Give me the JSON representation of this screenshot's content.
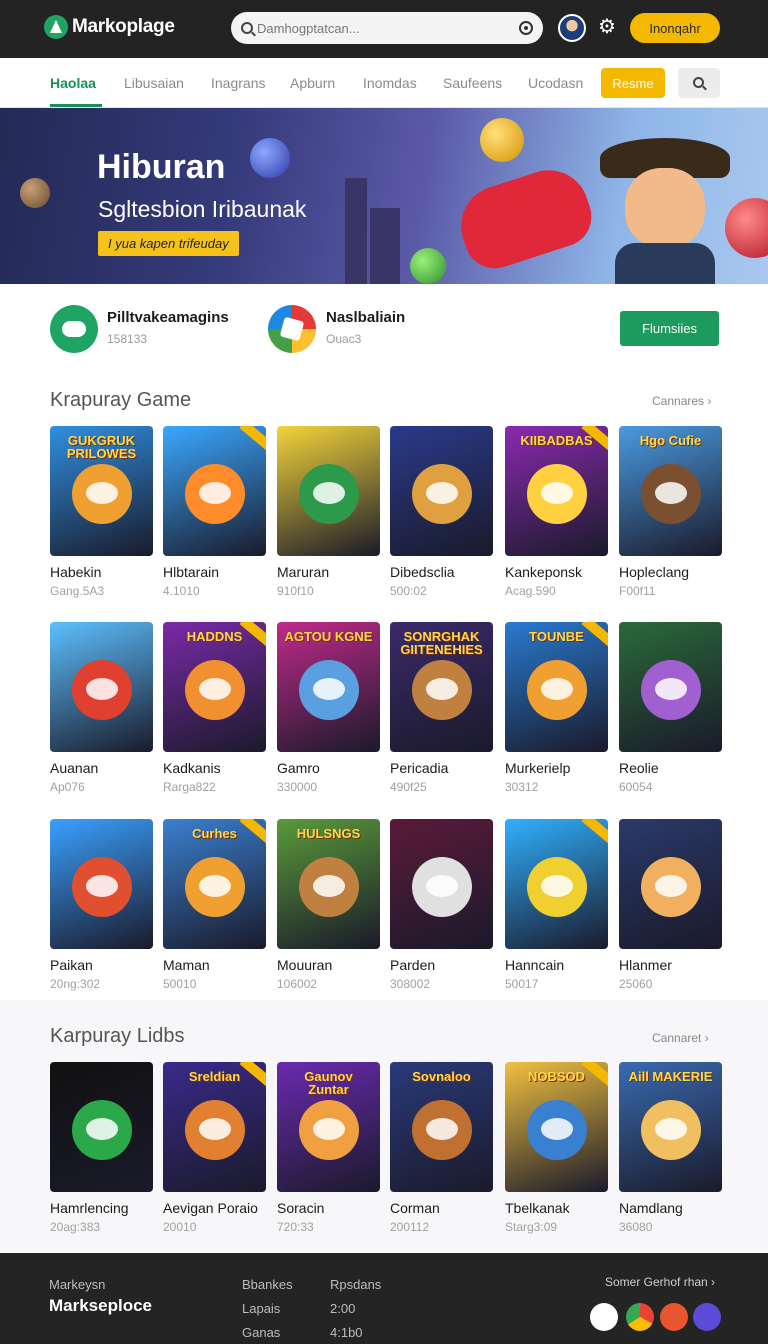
{
  "header": {
    "app_name": "Markoplage",
    "search_placeholder": "Damhogptatcan...",
    "cta_label": "Inonqahr",
    "icons": [
      "logo-icon",
      "search-icon",
      "mic-icon",
      "avatar",
      "gear-icon"
    ]
  },
  "nav": {
    "tabs": [
      "Haolaa",
      "Libusaian",
      "Inagrans",
      "Apburn",
      "Inomdas",
      "Saufeens",
      "Ucodasn"
    ],
    "active_tab": "Haolaa",
    "pill_label": "Resme"
  },
  "hero": {
    "title": "Hiburan",
    "subtitle": "Sgltesbion Iribaunak",
    "tag": "I yua kapen trifeuday"
  },
  "featured": {
    "items": [
      {
        "name": "Pilltvakeamagins",
        "meta": "158133"
      },
      {
        "name": "Naslbaliain",
        "meta": "Ouac3"
      }
    ],
    "button_label": "Flumsiies"
  },
  "section1": {
    "title": "Krapuray Game",
    "link": "Cannares",
    "cards": [
      {
        "name": "Habekin",
        "sub": "Gang.5A3",
        "art": "GUKGRUK PRILOWES"
      },
      {
        "name": "Hlbtarain",
        "sub": "4.1010",
        "art": ""
      },
      {
        "name": "Maruran",
        "sub": "910f10",
        "art": ""
      },
      {
        "name": "Dibedsclia",
        "sub": "500:02",
        "art": ""
      },
      {
        "name": "Kankeponsk",
        "sub": "Acag.590",
        "art": "KIIBADBAS"
      },
      {
        "name": "Hopleclang",
        "sub": "F00f11",
        "art": "Hgo Cufie"
      },
      {
        "name": "Auanan",
        "sub": "Ap076",
        "art": ""
      },
      {
        "name": "Kadkanis",
        "sub": "Rarga822",
        "art": "HADDNS"
      },
      {
        "name": "Gamro",
        "sub": "330000",
        "art": "AGTOU KGNE"
      },
      {
        "name": "Pericadia",
        "sub": "490f25",
        "art": "SONRGHAK GIITENEHIES"
      },
      {
        "name": "Murkerielp",
        "sub": "30312",
        "art": "TOUNBE"
      },
      {
        "name": "Reolie",
        "sub": "60054",
        "art": ""
      },
      {
        "name": "Paikan",
        "sub": "20ng:302",
        "art": ""
      },
      {
        "name": "Maman",
        "sub": "50010",
        "art": "Curhes"
      },
      {
        "name": "Mouuran",
        "sub": "106002",
        "art": "HULSNGS"
      },
      {
        "name": "Parden",
        "sub": "308002",
        "art": ""
      },
      {
        "name": "Hanncain",
        "sub": "50017",
        "art": ""
      },
      {
        "name": "Hlanmer",
        "sub": "25060",
        "art": ""
      }
    ]
  },
  "section2": {
    "title": "Karpuray Lidbs",
    "link": "Cannaret",
    "cards": [
      {
        "name": "Hamrlencing",
        "sub": "20ag:383",
        "art": ""
      },
      {
        "name": "Aevigan Poraio",
        "sub": "20010",
        "art": "Sreldian"
      },
      {
        "name": "Soracin",
        "sub": "720:33",
        "art": "Gaunov Zuntar"
      },
      {
        "name": "Corman",
        "sub": "200112",
        "art": "Sovnaloo"
      },
      {
        "name": "Tbelkanak",
        "sub": "Starg3:09",
        "art": "NOBSOD"
      },
      {
        "name": "Namdlang",
        "sub": "36080",
        "art": "Aill MAKERIE"
      }
    ]
  },
  "footer": {
    "col1_label": "Markeysn",
    "brand": "Markseploce",
    "col2": [
      "Bbankes",
      "Lapais",
      "Ganas"
    ],
    "col3": [
      "Rpsdans",
      "2:00",
      "4:1b0"
    ],
    "right_link": "Somer Gerhof rhan",
    "icons": [
      "feather-icon",
      "chrome-icon",
      "store-icon",
      "chat-icon"
    ]
  },
  "colors": {
    "accent": "#1d9a5d",
    "highlight": "#f5b800",
    "topbar": "#232323"
  }
}
